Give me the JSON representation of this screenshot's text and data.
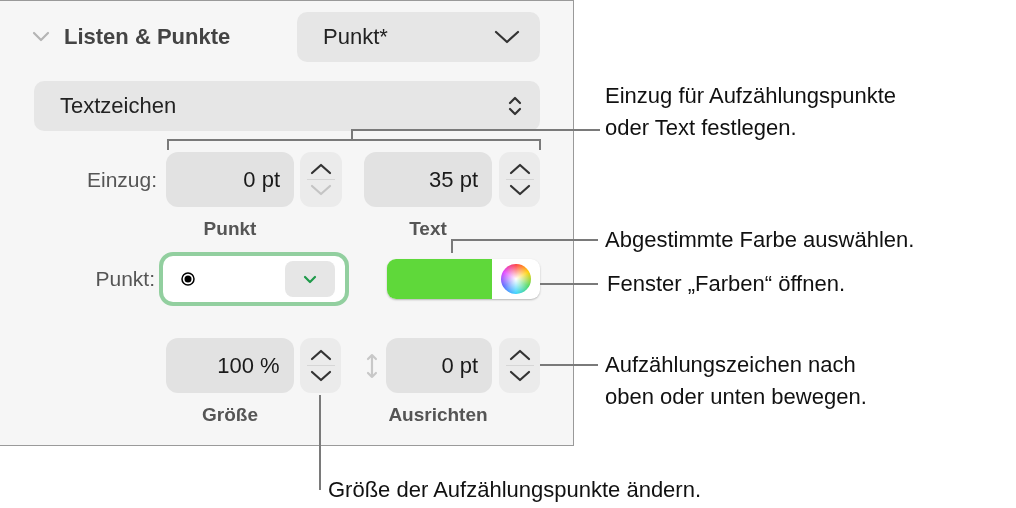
{
  "panel": {
    "title": "Listen & Punkte",
    "expanded": true,
    "style_popup": "Punkt*",
    "type_popup": "Textzeichen",
    "indent": {
      "label": "Einzug:",
      "fields": [
        {
          "value": "0 pt",
          "caption": "Punkt",
          "up_disabled": false,
          "down_disabled": true
        },
        {
          "value": "35 pt",
          "caption": "Text",
          "up_disabled": false,
          "down_disabled": false
        }
      ]
    },
    "bullet": {
      "label": "Punkt:",
      "focused": true,
      "color": "#5fd83a"
    },
    "size": {
      "value": "100 %",
      "caption": "Größe",
      "up_disabled": false,
      "down_disabled": false
    },
    "align": {
      "value": "0 pt",
      "caption": "Ausrichten",
      "up_disabled": false,
      "down_disabled": false
    }
  },
  "callouts": [
    {
      "kind": "indent",
      "text": "Einzug für Aufzählungspunkte\noder Text festlegen."
    },
    {
      "kind": "color",
      "text": "Abgestimmte Farbe auswählen."
    },
    {
      "kind": "colors_window",
      "text": "Fenster „Farben“ öffnen."
    },
    {
      "kind": "align",
      "text": "Aufzählungszeichen nach\noben oder unten bewegen."
    },
    {
      "kind": "size",
      "text": "Größe der Aufzählungspunkte ändern."
    }
  ]
}
